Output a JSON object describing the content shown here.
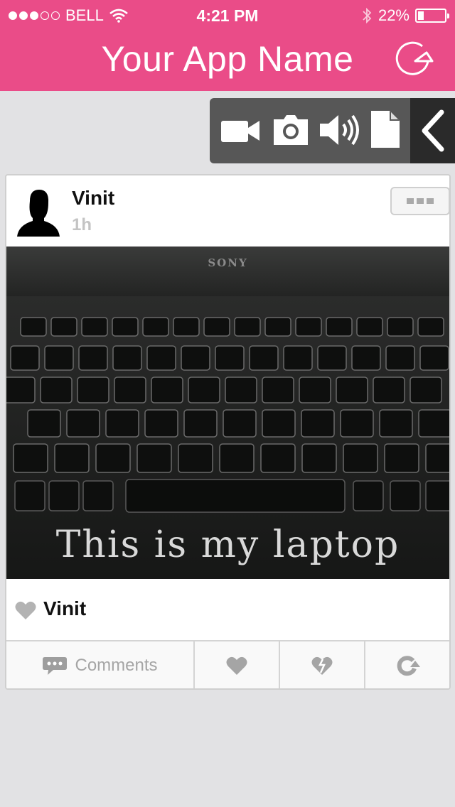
{
  "status_bar": {
    "carrier": "BELL",
    "time": "4:21 PM",
    "battery_text": "22%",
    "battery_level": 0.22,
    "signal_bars_filled": 3,
    "signal_bars_total": 5
  },
  "header": {
    "title": "Your App Name",
    "refresh_icon": "refresh-icon",
    "background_color": "#ea4c88"
  },
  "toolbar": {
    "tools": [
      "video-camera-icon",
      "camera-icon",
      "speaker-icon",
      "document-icon"
    ],
    "toggle_icon": "chevron-left-icon"
  },
  "post": {
    "author": "Vinit",
    "time_ago": "1h",
    "photo_brand": "SONY",
    "photo_caption": "This is my laptop",
    "liked_by": "Vinit",
    "actions": {
      "comments_label": "Comments",
      "like_icon": "heart-icon",
      "dislike_icon": "broken-heart-icon",
      "share_icon": "share-icon"
    }
  }
}
